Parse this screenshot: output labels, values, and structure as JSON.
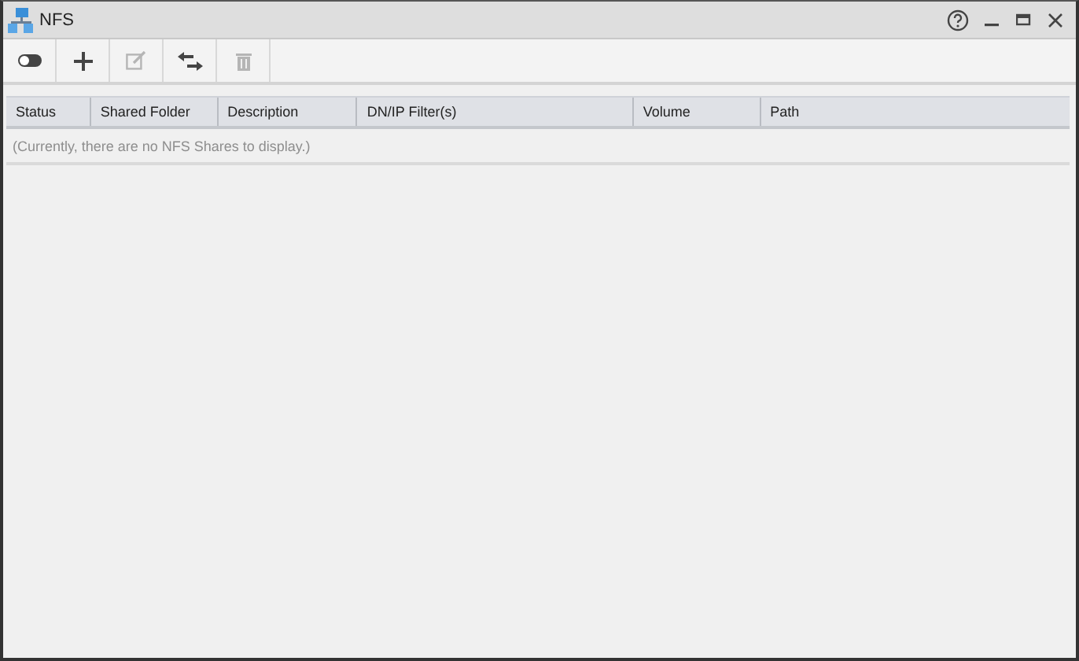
{
  "window": {
    "title": "NFS"
  },
  "toolbar": [
    {
      "kind": "toggle",
      "disabled": false
    },
    {
      "kind": "add",
      "disabled": false
    },
    {
      "kind": "edit",
      "disabled": true
    },
    {
      "kind": "transfer",
      "disabled": false
    },
    {
      "kind": "delete",
      "disabled": true
    }
  ],
  "table": {
    "columns": [
      {
        "label": "Status"
      },
      {
        "label": "Shared Folder"
      },
      {
        "label": "Description"
      },
      {
        "label": "DN/IP Filter(s)"
      },
      {
        "label": "Volume"
      },
      {
        "label": "Path"
      }
    ],
    "empty_message": "(Currently, there are no NFS Shares to display.)"
  }
}
